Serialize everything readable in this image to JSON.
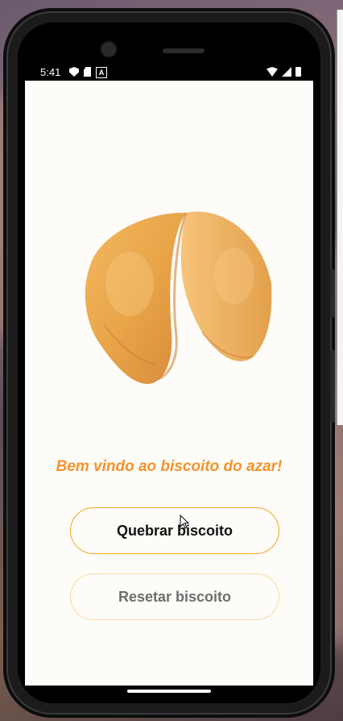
{
  "status_bar": {
    "time": "5:41",
    "left_icons": [
      "shield-icon",
      "sim-card-icon",
      "font-a-icon"
    ],
    "right_icons": [
      "wifi-icon",
      "signal-icon",
      "battery-icon"
    ]
  },
  "app": {
    "image_alt": "fortune-cookie",
    "welcome_text": "Bem vindo ao biscoito do azar!",
    "break_button_label": "Quebrar biscoito",
    "reset_button_label": "Resetar biscoito"
  },
  "colors": {
    "accent": "#f5922c",
    "background": "#fdfcf8",
    "button_border": "#f5a623"
  }
}
